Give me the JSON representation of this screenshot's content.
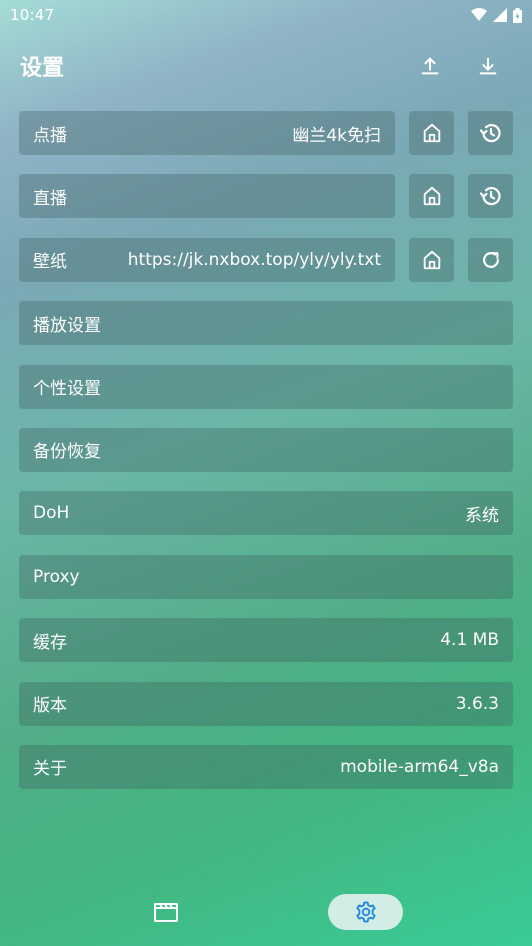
{
  "status_bar": {
    "time": "10:47"
  },
  "header": {
    "title": "设置"
  },
  "rows": {
    "vod": {
      "label": "点播",
      "value": "幽兰4k免扫"
    },
    "live": {
      "label": "直播",
      "value": ""
    },
    "wallpaper": {
      "label": "壁纸",
      "value": "https://jk.nxbox.top/yly/yly.txt"
    },
    "player": {
      "label": "播放设置"
    },
    "personal": {
      "label": "个性设置"
    },
    "backup": {
      "label": "备份恢复"
    },
    "doh": {
      "label": "DoH",
      "value": "系统"
    },
    "proxy": {
      "label": "Proxy"
    },
    "cache": {
      "label": "缓存",
      "value": "4.1 MB"
    },
    "version": {
      "label": "版本",
      "value": "3.6.3"
    },
    "about": {
      "label": "关于",
      "value": "mobile-arm64_v8a"
    }
  },
  "icons": {
    "upload": "upload-icon",
    "download": "download-icon",
    "home": "home-icon",
    "history": "history-icon",
    "refresh": "refresh-icon",
    "film": "clapperboard-icon",
    "settings": "gear-icon"
  },
  "colors": {
    "accent_nav": "#1e88e5"
  }
}
